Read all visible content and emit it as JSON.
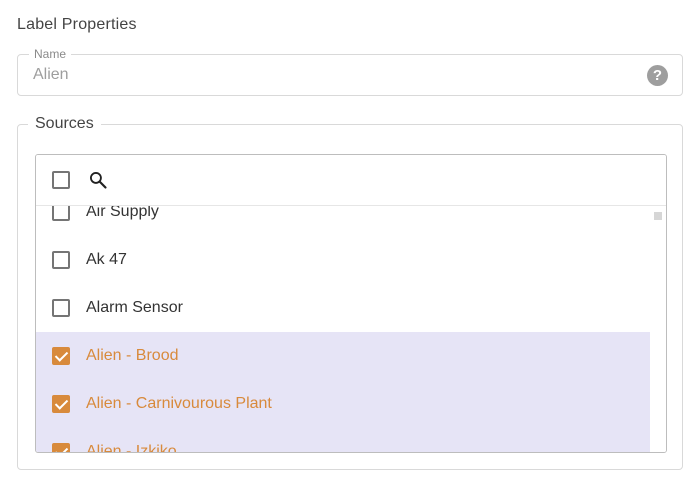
{
  "panel": {
    "title": "Label Properties"
  },
  "name_field": {
    "legend": "Name",
    "value": "Alien",
    "help_icon": "question-circle-icon"
  },
  "sources": {
    "legend": "Sources",
    "header_checked": false,
    "search_icon": "search-icon",
    "items": [
      {
        "label": "Air Supply",
        "checked": false
      },
      {
        "label": "Ak 47",
        "checked": false
      },
      {
        "label": "Alarm Sensor",
        "checked": false
      },
      {
        "label": "Alien - Brood",
        "checked": true
      },
      {
        "label": "Alien - Carnivourous Plant",
        "checked": true
      },
      {
        "label": "Alien - Izkiko",
        "checked": true
      }
    ]
  },
  "colors": {
    "accent": "#d88a3c",
    "selected_row": "#e6e4f6",
    "help_icon": "#9e9e9e"
  }
}
